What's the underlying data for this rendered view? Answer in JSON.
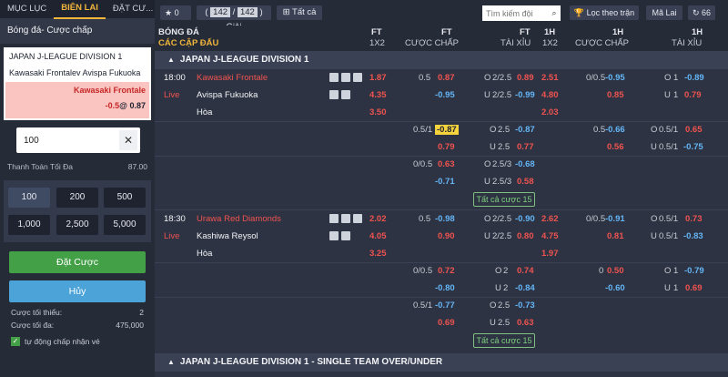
{
  "left": {
    "tabs": [
      "MỤC LỤC",
      "BIÊN LAI",
      "ĐẶT CƯ..."
    ],
    "title": "Bóng đá- Cược chấp",
    "slip": {
      "league": "JAPAN J-LEAGUE DIVISION 1",
      "match": "Kawasaki Frontalev Avispa Fukuoka",
      "selection": "Kawasaki Frontale",
      "handicap": "-0.5",
      "at": "@",
      "odds": "0.87"
    },
    "stake_value": "100",
    "max_pay_label": "Thanh Toán Tối Đa",
    "max_pay_value": "87.00",
    "quick": [
      "100",
      "200",
      "500",
      "1,000",
      "2,500",
      "5,000"
    ],
    "place_label": "Đặt Cược",
    "cancel_label": "Hủy",
    "min_label": "Cược tối thiểu:",
    "min_value": "2",
    "max_label": "Cược tối đa:",
    "max_value": "475,000",
    "auto_accept": "tự động chấp nhận vé"
  },
  "toolbar": {
    "fav_count": "0",
    "count_current": "142",
    "count_total": "142",
    "count_label": "Giải",
    "all_label": "Tất cả",
    "search_placeholder": "Tìm kiếm đội",
    "filter_label": "Lọc theo trận",
    "code_label": "Mã Lai",
    "refresh_label": "66"
  },
  "columns": {
    "sport": "BÓNG ĐÁ",
    "all_matches": "CÁC CẬP ĐẤU",
    "ft": "FT",
    "h1": "1H",
    "x12": "1X2",
    "hdp": "CƯỢC CHẤP",
    "ou": "TÀI XỈU"
  },
  "leagues": [
    {
      "name": "JAPAN J-LEAGUE DIVISION 1"
    },
    {
      "name": "JAPAN J-LEAGUE DIVISION 1 - SINGLE TEAM OVER/UNDER"
    }
  ],
  "matches": [
    {
      "time": "18:00",
      "status": "Live",
      "home": "Kawasaki Frontale",
      "away": "Avispa Fukuoka",
      "draw": "Hòa",
      "ft1x2": [
        "1.87",
        "4.35",
        "3.50"
      ],
      "fthdp_line": "0.5",
      "fthdp": [
        "0.87",
        "-0.95"
      ],
      "ftou": [
        {
          "side": "O",
          "line": "2/2.5",
          "odds": "0.89"
        },
        {
          "side": "U",
          "line": "2/2.5",
          "odds": "-0.99"
        }
      ],
      "h1x2": [
        "2.51",
        "4.80",
        "2.03"
      ],
      "h1hdp_line": "0/0.5",
      "h1hdp": [
        "-0.95",
        "0.85"
      ],
      "h1ou": [
        {
          "side": "O",
          "line": "1",
          "odds": "-0.89"
        },
        {
          "side": "U",
          "line": "1",
          "odds": "0.79"
        }
      ],
      "alt": [
        {
          "fthdp_line": "0.5/1",
          "fthdp": [
            "-0.87",
            "0.79"
          ],
          "ftou": [
            {
              "side": "O",
              "line": "2.5",
              "odds": "-0.87"
            },
            {
              "side": "U",
              "line": "2.5",
              "odds": "0.77"
            }
          ],
          "h1hdp_line": "0.5",
          "h1hdp": [
            "-0.66",
            "0.56"
          ],
          "h1ou": [
            {
              "side": "O",
              "line": "0.5/1",
              "odds": "0.65"
            },
            {
              "side": "U",
              "line": "0.5/1",
              "odds": "-0.75"
            }
          ]
        },
        {
          "fthdp_line": "0/0.5",
          "fthdp": [
            "0.63",
            "-0.71"
          ],
          "ftou": [
            {
              "side": "O",
              "line": "2.5/3",
              "odds": "-0.68"
            },
            {
              "side": "U",
              "line": "2.5/3",
              "odds": "0.58"
            }
          ]
        }
      ],
      "all_bets": "Tất cả cược 15"
    },
    {
      "time": "18:30",
      "status": "Live",
      "home": "Urawa Red Diamonds",
      "away": "Kashiwa Reysol",
      "draw": "Hòa",
      "ft1x2": [
        "2.02",
        "4.05",
        "3.25"
      ],
      "fthdp_line": "0.5",
      "fthdp": [
        "-0.98",
        "0.90"
      ],
      "ftou": [
        {
          "side": "O",
          "line": "2/2.5",
          "odds": "-0.90"
        },
        {
          "side": "U",
          "line": "2/2.5",
          "odds": "0.80"
        }
      ],
      "h1x2": [
        "2.62",
        "4.75",
        "1.97"
      ],
      "h1hdp_line": "0/0.5",
      "h1hdp": [
        "-0.91",
        "0.81"
      ],
      "h1ou": [
        {
          "side": "O",
          "line": "0.5/1",
          "odds": "0.73"
        },
        {
          "side": "U",
          "line": "0.5/1",
          "odds": "-0.83"
        }
      ],
      "alt": [
        {
          "fthdp_line": "0/0.5",
          "fthdp": [
            "0.72",
            "-0.80"
          ],
          "ftou": [
            {
              "side": "O",
              "line": "2",
              "odds": "0.74"
            },
            {
              "side": "U",
              "line": "2",
              "odds": "-0.84"
            }
          ],
          "h1hdp_line": "0",
          "h1hdp": [
            "0.50",
            "-0.60"
          ],
          "h1ou": [
            {
              "side": "O",
              "line": "1",
              "odds": "-0.79"
            },
            {
              "side": "U",
              "line": "1",
              "odds": "0.69"
            }
          ]
        },
        {
          "fthdp_line": "0.5/1",
          "fthdp": [
            "-0.77",
            "0.69"
          ],
          "ftou": [
            {
              "side": "O",
              "line": "2.5",
              "odds": "-0.73"
            },
            {
              "side": "U",
              "line": "2.5",
              "odds": "0.63"
            }
          ]
        }
      ],
      "all_bets": "Tất cả cược 15"
    }
  ],
  "colors": {
    "accent": "#f0b53a",
    "red": "#ef5350",
    "blue": "#64b5f6",
    "green": "#43a047"
  }
}
